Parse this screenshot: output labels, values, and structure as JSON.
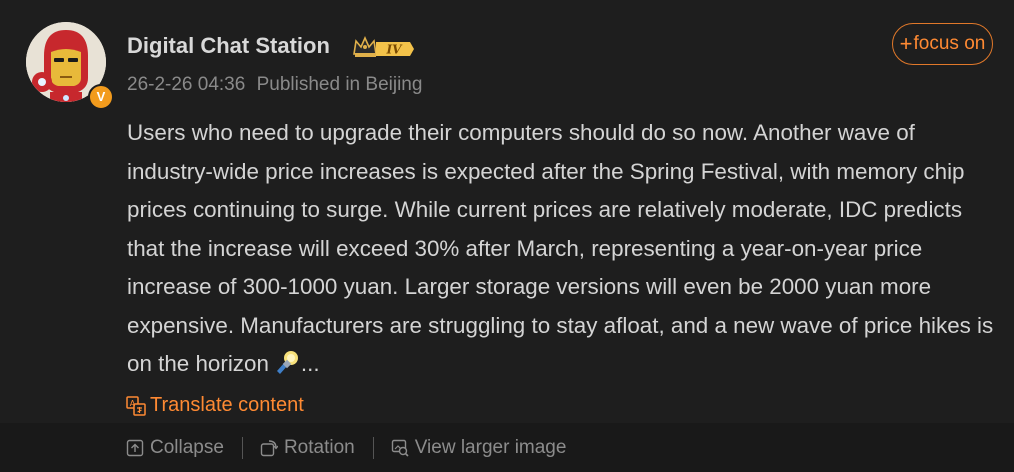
{
  "post": {
    "author": {
      "name": "Digital Chat Station",
      "level_badge": "IV",
      "verified_badge": "V"
    },
    "meta": {
      "timestamp": "26-2-26 04:36",
      "location": "Published in Beijing"
    },
    "follow_label": "focus on",
    "follow_icon": "+",
    "body": "Users who need to upgrade their computers should do so now. Another wave of industry-wide price increases is expected after the Spring Festival, with memory chip prices continuing to surge. While current prices are relatively moderate, IDC predicts that the increase will exceed 30% after March, representing a year-on-year price increase of 300-1000 yuan. Larger storage versions will even be 2000 yuan more expensive. Manufacturers are struggling to stay afloat, and a new wave of price hikes is on the horizon",
    "body_ellipsis": "...",
    "translate_label": "Translate content"
  },
  "toolbar": {
    "collapse_label": "Collapse",
    "rotation_label": "Rotation",
    "view_larger_label": "View larger image"
  },
  "colors": {
    "background": "#1e1e1e",
    "accent": "#ff8a33",
    "text": "#d4d4d4",
    "muted": "#8a8a8a"
  },
  "icons": {
    "avatar": "iron-man-cartoon-avatar",
    "level": "crown-level-icon",
    "emoji": "light-bulb-emoji-icon",
    "translate": "translate-icon",
    "collapse": "collapse-icon",
    "rotation": "rotate-icon",
    "view_larger": "view-larger-image-icon"
  }
}
